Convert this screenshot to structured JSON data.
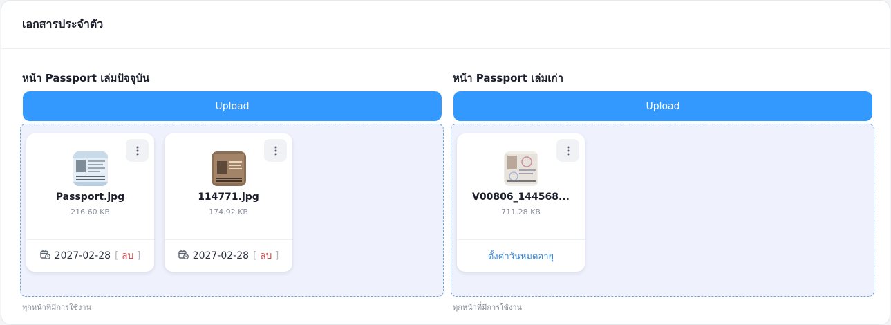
{
  "page": {
    "title": "เอกสารประจำตัว"
  },
  "sections": [
    {
      "title": "หน้า Passport เล่มปัจจุบัน",
      "upload_label": "Upload",
      "hint": "ทุกหน้าที่มีการใช้งาน",
      "files": [
        {
          "name": "Passport.jpg",
          "size": "216.60 KB",
          "date": "2027-02-28",
          "delete_label": "ลบ"
        },
        {
          "name": "114771.jpg",
          "size": "174.92 KB",
          "date": "2027-02-28",
          "delete_label": "ลบ"
        }
      ]
    },
    {
      "title": "หน้า Passport เล่มเก่า",
      "upload_label": "Upload",
      "hint": "ทุกหน้าที่มีการใช้งาน",
      "files": [
        {
          "name": "V00806_144568...",
          "size": "711.28 KB",
          "expiry_label": "ตั้งค่าวันหมดอายุ"
        }
      ]
    }
  ],
  "icons": {
    "menu": "more-vertical-icon",
    "calendar": "calendar-clock-icon"
  },
  "colors": {
    "accent": "#3399ff",
    "delete": "#d04a4a",
    "link": "#3a88d6",
    "dropzone_bg": "#eff2fc"
  }
}
